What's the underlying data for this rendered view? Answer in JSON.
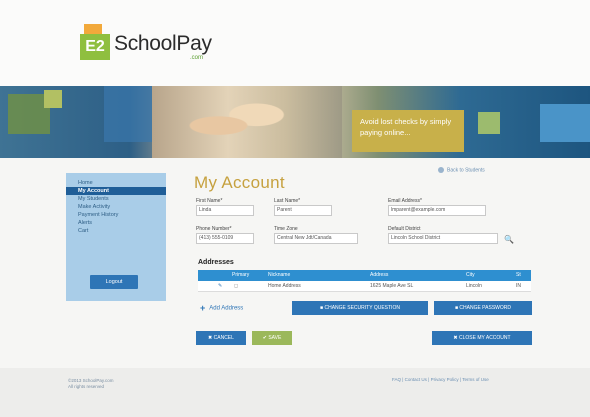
{
  "brand": {
    "logo_letters": "E2",
    "name": "SchoolPay",
    "sub": ".com"
  },
  "banner": {
    "tagline": "Avoid lost checks by simply paying online..."
  },
  "sidebar": {
    "items": [
      {
        "label": "Home",
        "active": false
      },
      {
        "label": "My Account",
        "active": true
      },
      {
        "label": "My Students",
        "active": false
      },
      {
        "label": "Make Activity",
        "active": false
      },
      {
        "label": "Payment History",
        "active": false
      },
      {
        "label": "Alerts",
        "active": false
      },
      {
        "label": "Cart",
        "active": false
      }
    ],
    "logout": "Logout"
  },
  "account": {
    "title": "My Account",
    "top_link": "Back to Students",
    "first_name_label": "First Name*",
    "first_name": "Linda",
    "last_name_label": "Last Name*",
    "last_name": "Parent",
    "email_label": "Email Address*",
    "email": "lmparent@example.com",
    "phone_label": "Phone Number*",
    "phone": "(413) 555-0109",
    "timezone_label": "Time Zone",
    "timezone": "Central New Jdt/Canada",
    "district_label": "Default District",
    "district": "Lincoln School District"
  },
  "addresses": {
    "heading": "Addresses",
    "columns": [
      "Primary",
      "Nickname",
      "Address",
      "City",
      "St"
    ],
    "rows": [
      {
        "nickname": "Home Address",
        "address": "1625 Maple Ave SL",
        "city": "Lincoln",
        "st": "IN"
      }
    ],
    "add_label": "Add Address"
  },
  "buttons": {
    "change_security": "CHANGE SECURITY QUESTION",
    "change_password": "CHANGE PASSWORD",
    "cancel": "CANCEL",
    "save": "SAVE",
    "close_account": "CLOSE MY ACCOUNT"
  },
  "footer": {
    "copyright_1": "©2013 SchoolPay.com",
    "copyright_2": "All rights reserved",
    "links": "FAQ | Contact Us | Privacy Policy | Terms of Use"
  }
}
